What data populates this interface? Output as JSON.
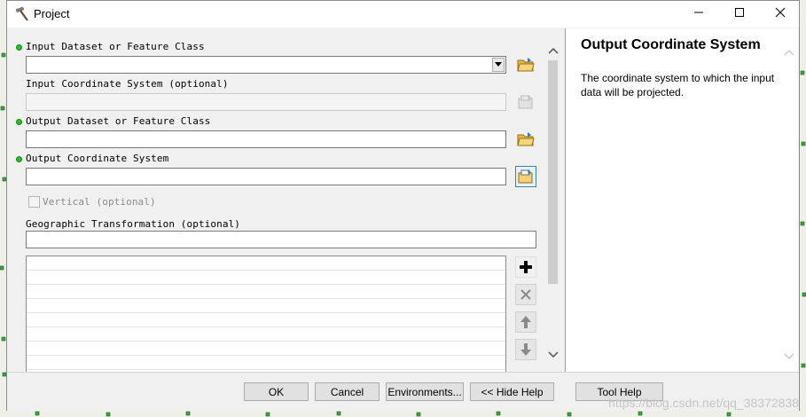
{
  "window": {
    "title": "Project"
  },
  "form": {
    "input_dataset_label": "Input Dataset or Feature Class",
    "input_dataset_value": "",
    "input_cs_label": "Input Coordinate System (optional)",
    "input_cs_value": "",
    "output_dataset_label": "Output Dataset or Feature Class",
    "output_dataset_value": "",
    "output_cs_label": "Output Coordinate System",
    "output_cs_value": "",
    "vertical_label": "Vertical (optional)",
    "geo_transform_label": "Geographic Transformation (optional)",
    "geo_transform_value": ""
  },
  "help": {
    "title": "Output Coordinate System",
    "body": "The coordinate system to which the input data will be projected."
  },
  "buttons": {
    "ok": "OK",
    "cancel": "Cancel",
    "environments": "Environments...",
    "hide_help": "<< Hide Help",
    "tool_help": "Tool Help"
  },
  "watermark": "https://blog.csdn.net/qq_38372838",
  "colors": {
    "required_dot": "#22c022",
    "focus_border": "#3c7fb1",
    "window_bg": "#f0f0f0"
  },
  "icons": {
    "app": "hammer-icon",
    "browse": "folder-open-icon",
    "cs_properties": "spatial-reference-icon",
    "add": "plus-icon",
    "remove": "x-icon",
    "move_up": "arrow-up-icon",
    "move_down": "arrow-down-icon"
  }
}
